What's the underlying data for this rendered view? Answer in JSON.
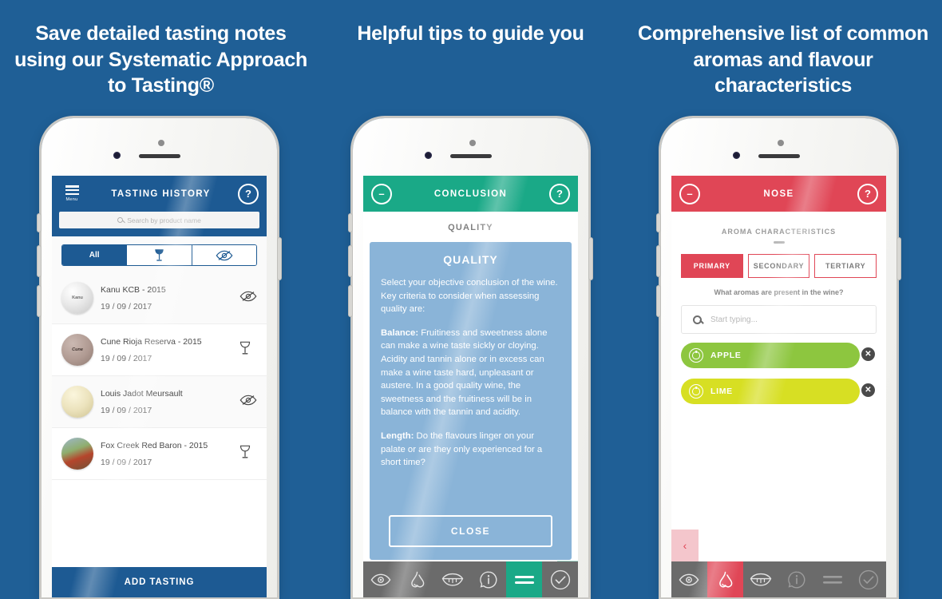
{
  "headings": {
    "col1": "Save detailed tasting notes using our Systematic Approach to Tasting®",
    "col2": "Helpful tips to guide you",
    "col3": "Comprehensive list of common aromas and flavour characteristics"
  },
  "colors": {
    "background": "#1f5f96",
    "blue_accent": "#1d5a93",
    "green_accent": "#1aa987",
    "red_accent": "#e04656",
    "tooltip_blue": "#8ab4d8",
    "nav_grey": "#6b6b6b",
    "chip_apple": "#8dc63f",
    "chip_lime": "#d7df23"
  },
  "phone1": {
    "menu_label": "Menu",
    "title": "TASTING HISTORY",
    "help_label": "?",
    "search": {
      "placeholder": "Search by product name",
      "value": ""
    },
    "filters": [
      {
        "label": "All",
        "icon": "text",
        "active": true
      },
      {
        "label": "",
        "icon": "wine-glass-icon",
        "active": false
      },
      {
        "label": "",
        "icon": "blind-eye-icon",
        "active": false
      }
    ],
    "rows": [
      {
        "thumb_label": "Kanu",
        "name": "Kanu KCB - 2015",
        "date": "19 / 09 / 2017",
        "icon": "blind-eye-icon"
      },
      {
        "thumb_label": "Cune",
        "name": "Cune Rioja Reserva - 2015",
        "date": "19 / 09 / 2017",
        "icon": "wine-glass-icon"
      },
      {
        "thumb_label": "",
        "name": "Louis Jadot Meursault",
        "date": "19 / 09 / 2017",
        "icon": "blind-eye-icon"
      },
      {
        "thumb_label": "",
        "name": "Fox Creek Red Baron - 2015",
        "date": "19 / 09 / 2017",
        "icon": "wine-glass-icon"
      }
    ],
    "add_button": "ADD TASTING"
  },
  "phone2": {
    "minimize_label": "–",
    "title": "CONCLUSION",
    "help_label": "?",
    "section_behind": "QUALITY",
    "tooltip": {
      "title": "QUALITY",
      "paragraph1": "Select your objective conclusion of the wine. Key criteria to consider when assessing quality are:",
      "p2_lead": "Balance:",
      "paragraph2": " Fruitiness and sweetness alone can make a wine taste sickly or cloying. Acidity and tannin alone or in excess can make a wine taste hard, unpleasant or austere. In a good quality wine, the sweetness and the fruitiness will be in balance with the tannin and acidity.",
      "p3_lead": "Length:",
      "paragraph3": " Do the flavours linger on your palate or are they only experienced for a short time?",
      "close_button": "CLOSE"
    },
    "nav": [
      {
        "icon": "eye-icon",
        "active": false
      },
      {
        "icon": "nose-icon",
        "active": false
      },
      {
        "icon": "mouth-icon",
        "active": false
      },
      {
        "icon": "info-bubble-icon",
        "active": false
      },
      {
        "icon": "equals-conclusion-icon",
        "active": true
      },
      {
        "icon": "check-circle-icon",
        "active": false
      }
    ]
  },
  "phone3": {
    "minimize_label": "–",
    "title": "NOSE",
    "help_label": "?",
    "section_title": "AROMA CHARACTERISTICS",
    "tabs": [
      {
        "label": "PRIMARY",
        "active": true
      },
      {
        "label": "SECONDARY",
        "active": false
      },
      {
        "label": "TERTIARY",
        "active": false
      }
    ],
    "question": "What aromas are present in the wine?",
    "search": {
      "placeholder": "Start typing...",
      "value": ""
    },
    "chips": [
      {
        "label": "APPLE",
        "color": "#8dc63f",
        "icon": "apple-icon",
        "remove": "✕"
      },
      {
        "label": "LIME",
        "color": "#d7df23",
        "icon": "apple-icon",
        "remove": "✕"
      }
    ],
    "back_label": "‹",
    "nav": [
      {
        "icon": "eye-icon",
        "active": false
      },
      {
        "icon": "nose-icon",
        "active": true
      },
      {
        "icon": "mouth-icon",
        "active": false
      },
      {
        "icon": "info-bubble-icon",
        "active": false
      },
      {
        "icon": "equals-conclusion-icon",
        "active": false
      },
      {
        "icon": "check-circle-icon",
        "active": false
      }
    ]
  }
}
